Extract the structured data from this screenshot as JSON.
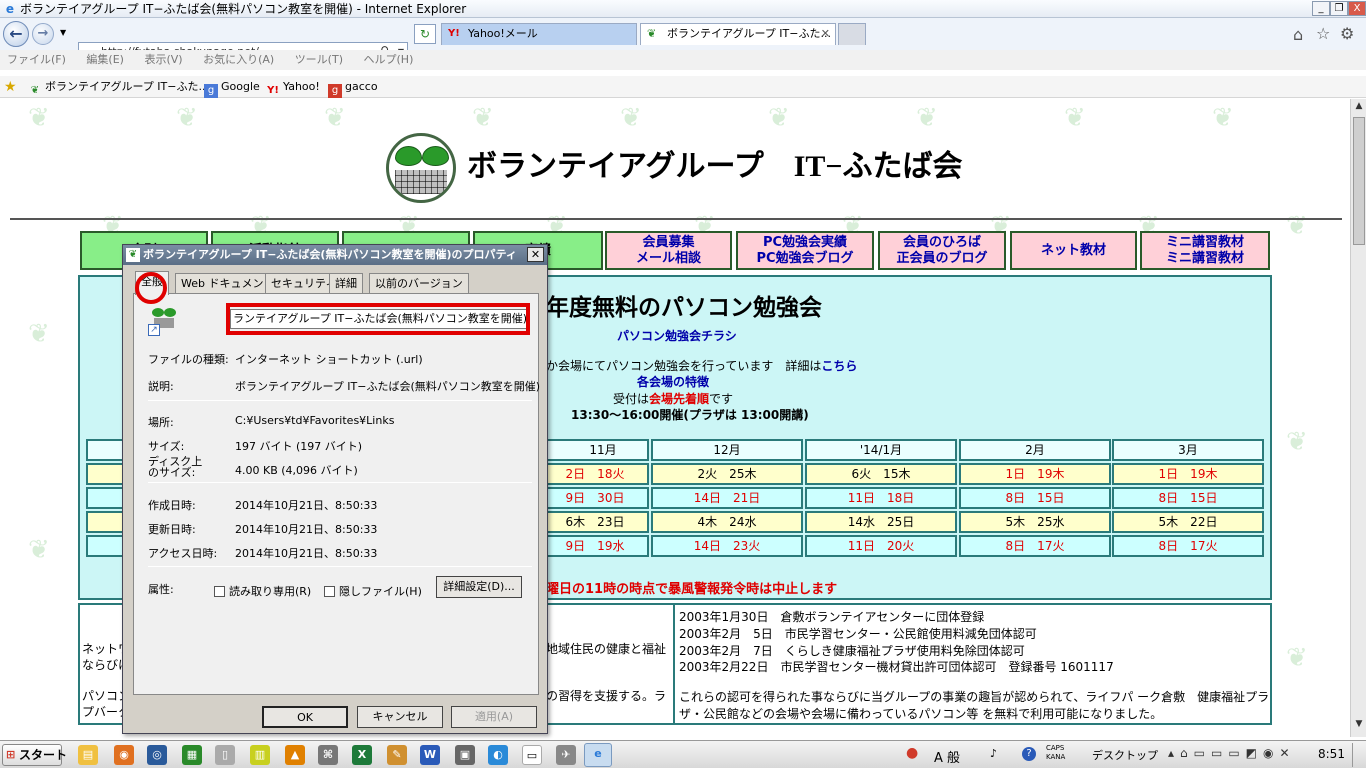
{
  "window": {
    "title": "ボランテイアグループ IT−ふたば会(無料パソコン教室を開催) - Internet Explorer",
    "controls": [
      "_",
      "❐",
      "X"
    ]
  },
  "address": {
    "url": "http://futaba.shakunage.net/",
    "search_icon": "search-icon"
  },
  "tabs": [
    {
      "label": "Yahoo!メール"
    },
    {
      "label": "ボランテイアグループ IT−ふた..."
    }
  ],
  "menu": [
    "ファイル(F)",
    "編集(E)",
    "表示(V)",
    "お気に入り(A)",
    "ツール(T)",
    "ヘルプ(H)"
  ],
  "favorites": [
    {
      "label": "ボランテイアグループ IT−ふた...",
      "icon": "sprout-icon"
    },
    {
      "label": "Google",
      "icon": "google-icon"
    },
    {
      "label": "Yahoo!",
      "icon": "yahoo-icon"
    },
    {
      "label": "gacco",
      "icon": "gacco-icon"
    }
  ],
  "site": {
    "title": "ボランテイアグループ　IT−ふたば会",
    "nav": [
      {
        "line1": "会則",
        "line2": "",
        "color": "green"
      },
      {
        "line1": "活動指針",
        "line2": "",
        "color": "green"
      },
      {
        "line1": "",
        "line2": "",
        "color": "green"
      },
      {
        "line1": "実績",
        "line2": "",
        "color": "green"
      },
      {
        "line1": "会員募集",
        "line2": "メール相談",
        "color": "pink"
      },
      {
        "line1": "PC勉強会実績",
        "line2": "PC勉強会ブログ",
        "color": "pink"
      },
      {
        "line1": "会員のひろば",
        "line2": "正会員のブログ",
        "color": "pink"
      },
      {
        "line1": "ネット教材",
        "line2": "",
        "color": "pink"
      },
      {
        "line1": "ミニ講習教材",
        "line2": "ミニ講習教材",
        "color": "pink"
      }
    ],
    "heading": "年度無料のパソコン勉強会",
    "flyer_link": "パソコン勉強会チラシ",
    "intro_prefix": "か会場にてパソコン勉強会を行っています　詳細は",
    "intro_link": "こちら",
    "features": "各会場の特徴",
    "reception_prefix": "受付は",
    "reception_red": "会場先着順",
    "reception_suffix": "です",
    "hours": "13:30〜16:00開催(プラザは 13:00開講)",
    "schedule": {
      "months": [
        "11月",
        "12月",
        "'14/1月",
        "2月",
        "3月"
      ],
      "rows": [
        [
          "2日　18火",
          "2火　25木",
          "6火　15木",
          "1日　19木",
          "1日　19木"
        ],
        [
          "9日　30日",
          "14日　21日",
          "11日　18日",
          "8日　15日",
          "8日　15日"
        ],
        [
          "6木　23日",
          "4木　24水",
          "14水　25日",
          "5木　25水",
          "5木　22日"
        ],
        [
          "9日　19水",
          "14日　23火",
          "11日　20火",
          "8日　17火",
          "8日　17火"
        ]
      ]
    },
    "notice": "曜日の11時の時点で暴風警報発令時は中止します",
    "left_text": [
      "ネットワ",
      "ならびに",
      "パソコン",
      "プバーク"
    ],
    "mid_text": [
      "地域住民の健康と福祉",
      "の習得を支援する。ラ"
    ],
    "history": [
      "2003年1月30日　倉敷ボランテイアセンターに団体登録",
      "2003年2月　5日　市民学習センター・公民館使用料減免団体認可",
      "2003年2月　7日　くらしき健康福祉プラザ使用料免除団体認可",
      "2003年2月22日　市民学習センター機材貸出許可団体認可　登録番号 1601117"
    ],
    "history_note": [
      "これらの認可を得られた事ならびに当グループの事業の趣旨が認められて、ライフパ ーク倉敷　健康福祉プラ",
      "ザ・公民館などの会場や会場に備わっているパソコン等 を無料で利用可能になりました。"
    ]
  },
  "dialog": {
    "title": "ボランテイアグループ IT−ふたば会(無料パソコン教室を開催)のプロパティ",
    "tabs": [
      "全般",
      "Web ドキュメント",
      "セキュリティ",
      "詳細",
      "以前のバージョン"
    ],
    "name_value": "ランテイアグループ IT−ふたば会(無料パソコン教室を開催)",
    "file_type_label": "ファイルの種類:",
    "file_type": "インターネット ショートカット (.url)",
    "desc_label": "説明:",
    "desc": "ボランテイアグループ IT−ふたば会(無料パソコン教室を開催)",
    "location_label": "場所:",
    "location": "C:¥Users¥td¥Favorites¥Links",
    "size_label": "サイズ:",
    "size": "197 バイト (197 バイト)",
    "disk_size_label1": "ディスク上",
    "disk_size_label2": "のサイズ:",
    "disk_size": "4.00 KB (4,096 バイト)",
    "created_label": "作成日時:",
    "created": "2014年10月21日、8:50:33",
    "modified_label": "更新日時:",
    "modified": "2014年10月21日、8:50:33",
    "accessed_label": "アクセス日時:",
    "accessed": "2014年10月21日、8:50:33",
    "attr_label": "属性:",
    "readonly_label": "読み取り専用(R)",
    "hidden_label": "隠しファイル(H)",
    "advanced_button": "詳細設定(D)...",
    "ok": "OK",
    "cancel": "キャンセル",
    "apply": "適用(A)",
    "highlight_color": "#e00000"
  },
  "taskbar": {
    "start": "スタート",
    "lang": "A 般",
    "caps": "CAPS",
    "kana": "KANA",
    "desktop": "デスクトップ",
    "clock": "8:51"
  }
}
